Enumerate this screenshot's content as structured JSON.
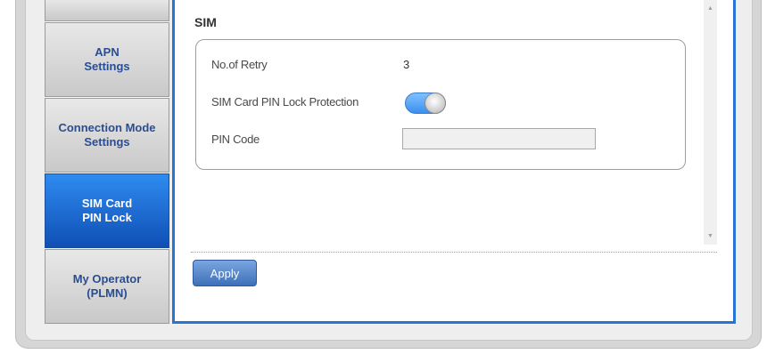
{
  "sidebar": {
    "items": [
      {
        "label": ""
      },
      {
        "label": "APN\nSettings"
      },
      {
        "label": "Connection Mode\nSettings"
      },
      {
        "label": "SIM Card\nPIN Lock",
        "active": true
      },
      {
        "label": "My Operator\n(PLMN)"
      }
    ]
  },
  "main": {
    "section_title": "SIM",
    "rows": {
      "retry_label": "No.of Retry",
      "retry_value": "3",
      "pin_lock_label": "SIM Card PIN Lock Protection",
      "pin_lock_enabled": true,
      "pin_code_label": "PIN Code",
      "pin_code_value": ""
    },
    "apply_label": "Apply"
  },
  "colors": {
    "accent": "#2674d6",
    "active_tab": "#0f4fb5",
    "tab_text": "#2a4d92"
  }
}
